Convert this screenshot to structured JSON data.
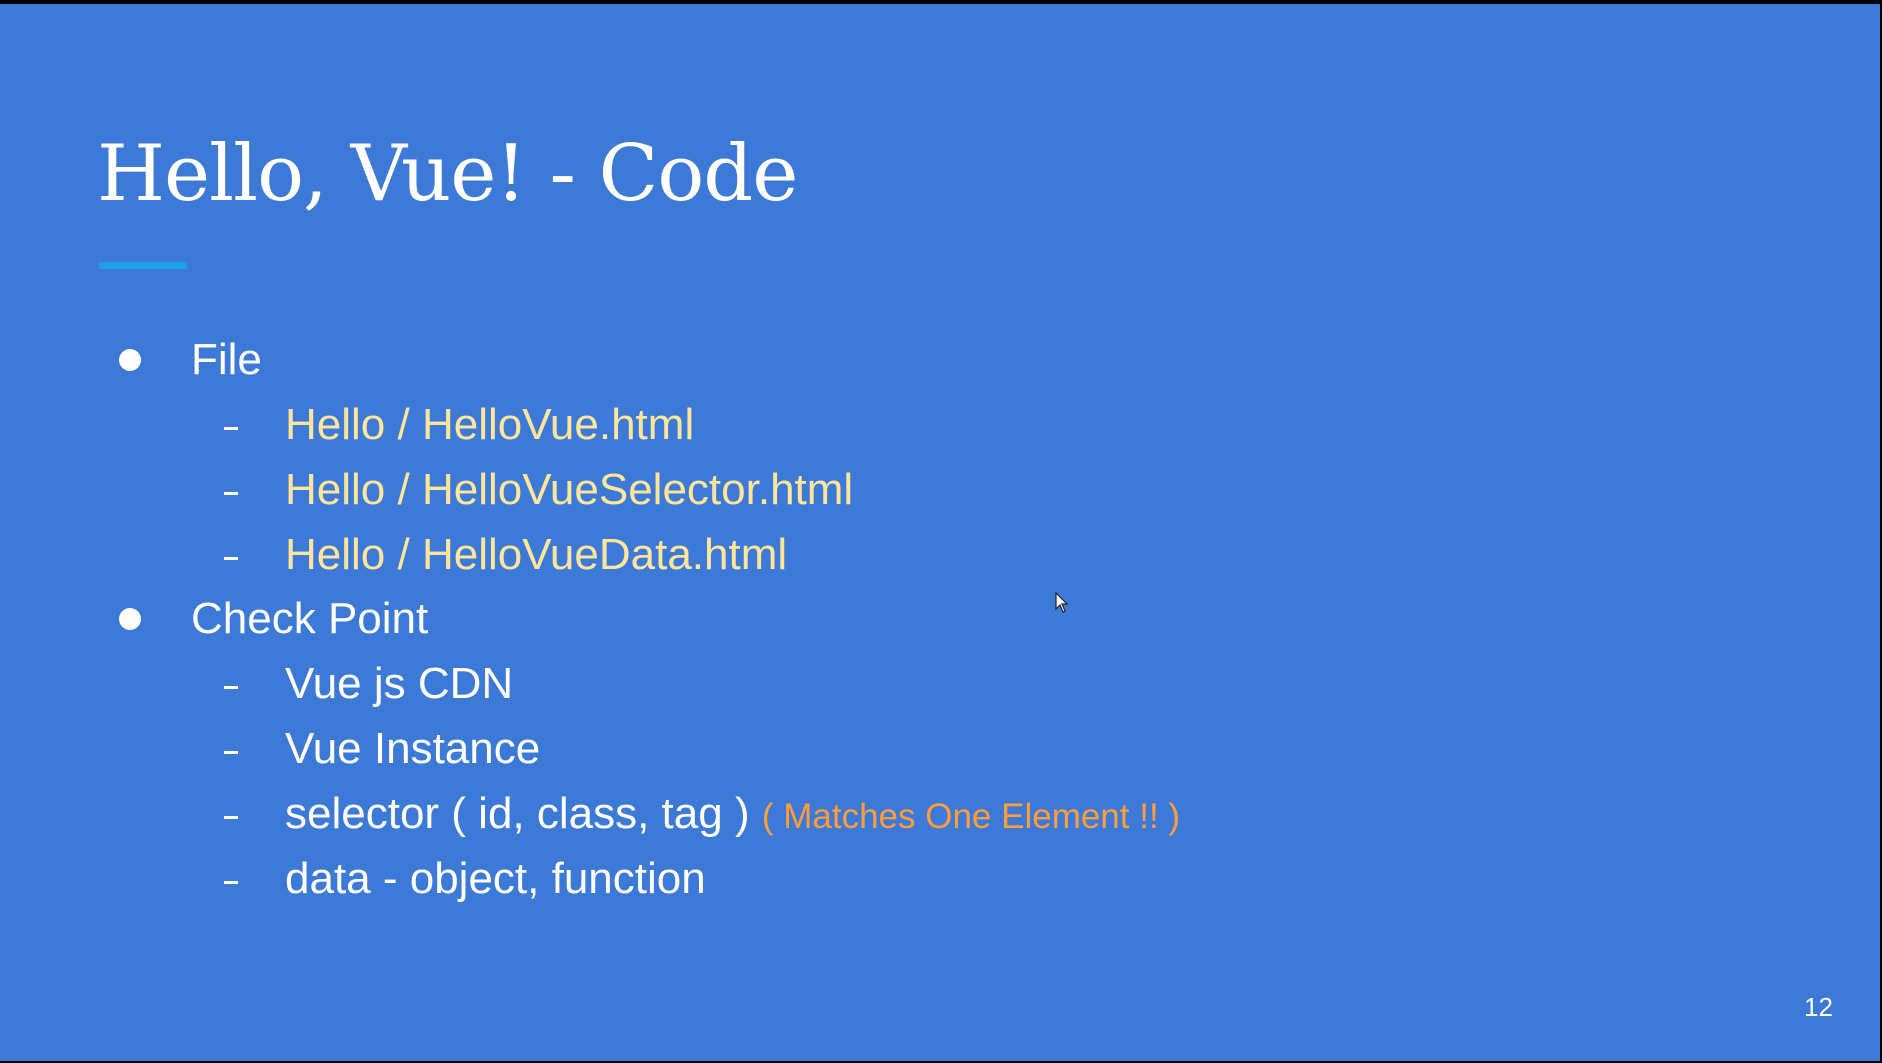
{
  "slide": {
    "title": "Hello, Vue! - Code",
    "page_number": "12",
    "sections": [
      {
        "label": "File",
        "items": [
          {
            "text": "Hello / HelloVue.html"
          },
          {
            "text": "Hello / HelloVueSelector.html"
          },
          {
            "text": "Hello / HelloVueData.html"
          }
        ]
      },
      {
        "label": "Check Point",
        "items": [
          {
            "text": "Vue js CDN"
          },
          {
            "text": "Vue Instance"
          },
          {
            "text": "selector ( id, class, tag )",
            "note": "( Matches One Element !! )"
          },
          {
            "text": "data - object, function"
          }
        ]
      }
    ]
  },
  "colors": {
    "background": "#3d79d7",
    "title_text": "#ffffff",
    "title_rule": "#1ea0e6",
    "file_item_text": "#ffe59a",
    "note_text": "#ff9c3b"
  },
  "icons": {
    "bullet": "disc-bullet-icon",
    "sub_bullet": "dash-bullet-icon",
    "pointer": "mouse-pointer-icon"
  }
}
